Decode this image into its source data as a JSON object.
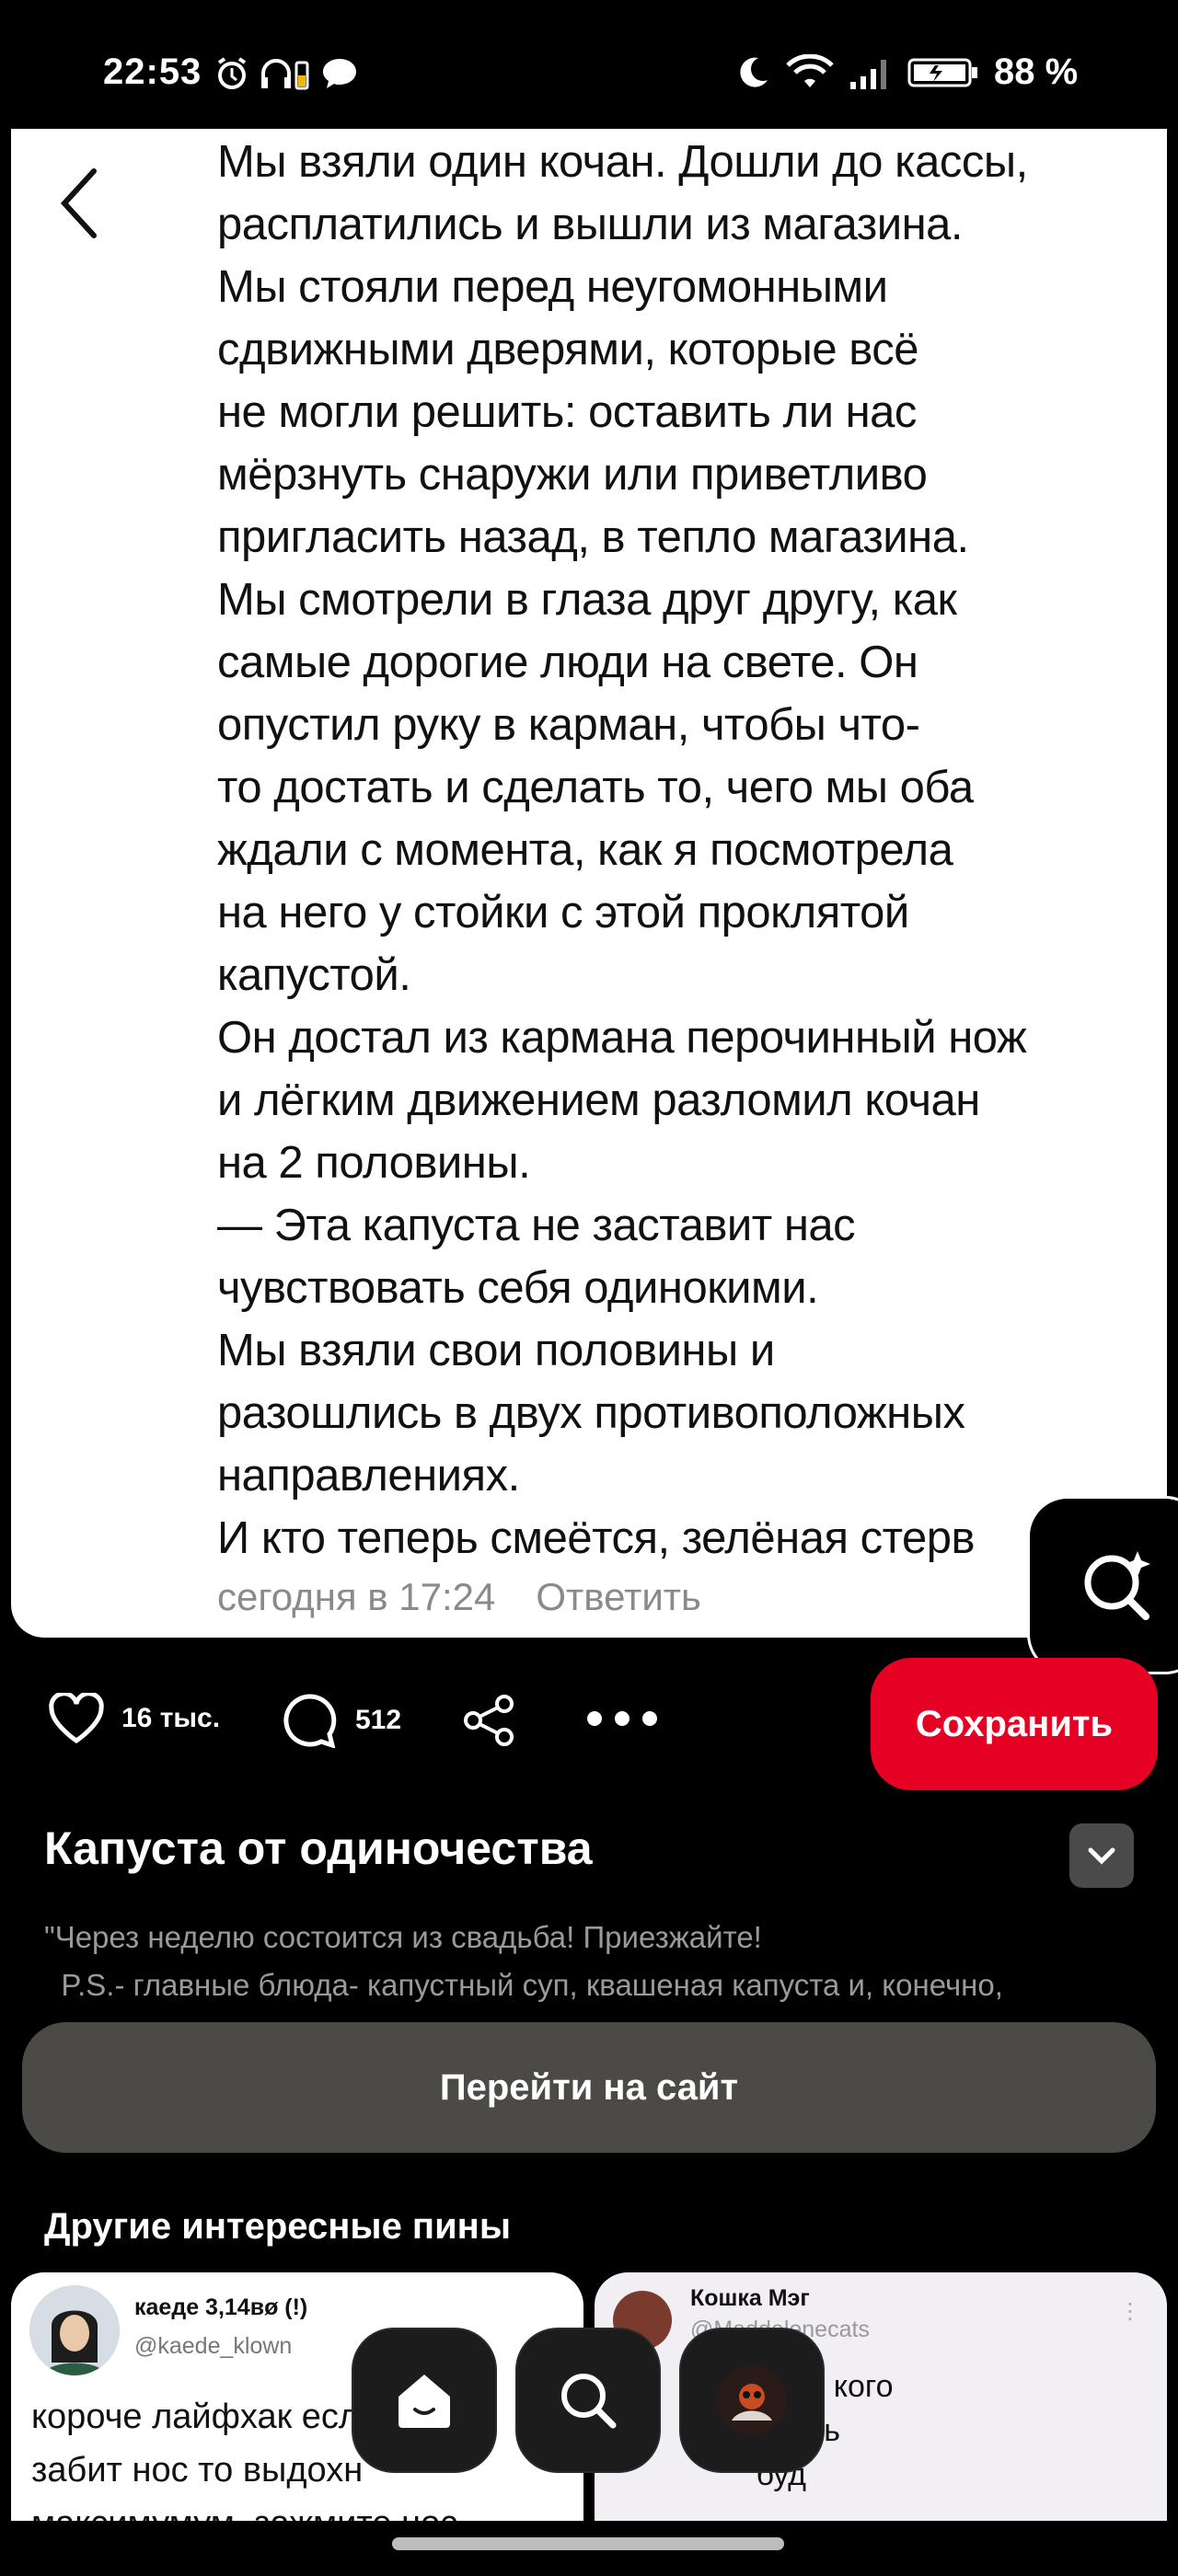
{
  "status_bar": {
    "time": "22:53",
    "battery": "88 %",
    "left_icons": [
      "alarm-icon",
      "headphones-battery-icon",
      "chat-icon"
    ],
    "right_icons": [
      "moon-icon",
      "wifi-icon",
      "signal-icon",
      "battery-icon"
    ]
  },
  "pin": {
    "text": "Мы взяли один кочан. Дошли до кассы,\nрасплатились и вышли из магазина.\nМы стояли перед неугомонными\nсдвижными дверями, которые всё\nне могли решить: оставить ли нас\nмёрзнуть снаружи или приветливо\nпригласить назад, в тепло магазина.\nМы смотрели в глаза друг другу, как\nсамые дорогие люди на свете. Он\nопустил руку в карман, чтобы что-\nто достать и сделать то, чего мы оба\nждали с момента, как я посмотрела\nна него у стойки с этой проклятой\nкапустой.\nОн достал из кармана перочинный нож\nи лёгким движением разломил кочан\nна 2 половины.\n— Эта капуста не заставит нас\nчувствовать себя одинокими.\nМы взяли свои половины и\nразошлись в двух противоположных\nнаправлениях.\nИ кто теперь смеётся, зелёная стерв",
    "meta_time": "сегодня в 17:24",
    "meta_reply": "Ответить"
  },
  "actions": {
    "likes": "16 тыс.",
    "comments": "512",
    "save_label": "Сохранить"
  },
  "title": "Капуста от одиночества",
  "description": "\"Через неделю состоится из свадьба! Приезжайте!\n  P.S.- главные блюда- капустный суп, квашеная капуста и, конечно,",
  "visit_site_label": "Перейти на сайт",
  "more_pins_title": "Другие интересные пины",
  "more_pins": [
    {
      "name": "каеде 3,14вø (!)",
      "handle": "@kaede_klown",
      "body": "короче лайфхак есл\nзабит нос то выдохн\nмаксимумум, зажмите нос"
    },
    {
      "name": "Кошка Мэг",
      "handle": "@Maddelenecats",
      "body": "            , в кого\n              сь\n        буд"
    }
  ],
  "nav": [
    "home-icon",
    "search-icon",
    "profile-avatar"
  ],
  "colors": {
    "save": "#e60023",
    "visit": "#4b4a46",
    "background": "#000000"
  }
}
